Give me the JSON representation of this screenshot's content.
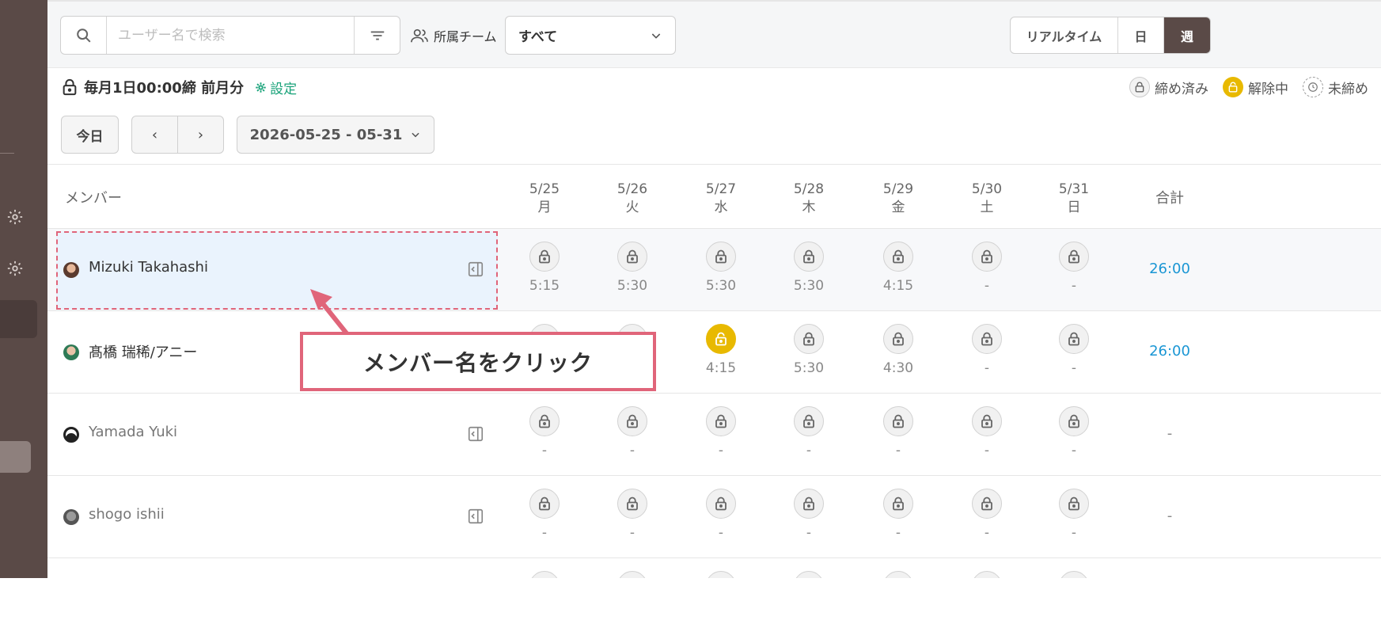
{
  "search": {
    "placeholder": "ユーザー名で検索",
    "value": ""
  },
  "team_filter": {
    "label": "所属チーム",
    "selected": "すべて"
  },
  "view_modes": [
    "リアルタイム",
    "日",
    "週"
  ],
  "view_mode_selected": "週",
  "closing": {
    "text": "毎月1日00:00締 前月分",
    "settings_label": "設定"
  },
  "legend": [
    {
      "label": "締め済み",
      "icon": "lock-closed-icon"
    },
    {
      "label": "解除中",
      "icon": "lock-open-icon"
    },
    {
      "label": "未締め",
      "icon": "clock-icon"
    }
  ],
  "nav": {
    "today": "今日",
    "prev": "‹",
    "next": "›",
    "date_range": "2026-05-25 - 05-31"
  },
  "columns": {
    "member": "メンバー",
    "total": "合計",
    "days": [
      {
        "date": "5/25",
        "weekday": "月"
      },
      {
        "date": "5/26",
        "weekday": "火"
      },
      {
        "date": "5/27",
        "weekday": "水"
      },
      {
        "date": "5/28",
        "weekday": "木"
      },
      {
        "date": "5/29",
        "weekday": "金"
      },
      {
        "date": "5/30",
        "weekday": "土"
      },
      {
        "date": "5/31",
        "weekday": "日"
      }
    ]
  },
  "members": [
    {
      "name": "Mizuki Takahashi",
      "total": "26:00",
      "times": [
        "5:15",
        "5:30",
        "5:30",
        "5:30",
        "4:15",
        "-",
        "-"
      ],
      "status": [
        "closed",
        "closed",
        "closed",
        "closed",
        "closed",
        "closed",
        "closed"
      ]
    },
    {
      "name": "髙橋 瑞稀/アニー",
      "total": "26:00",
      "times": [
        "",
        "",
        "4:15",
        "5:30",
        "4:30",
        "-",
        "-"
      ],
      "status": [
        "closed",
        "closed",
        "open",
        "closed",
        "closed",
        "closed",
        "closed"
      ]
    },
    {
      "name": "Yamada Yuki",
      "total": "-",
      "times": [
        "-",
        "-",
        "-",
        "-",
        "-",
        "-",
        "-"
      ],
      "status": [
        "closed",
        "closed",
        "closed",
        "closed",
        "closed",
        "closed",
        "closed"
      ]
    },
    {
      "name": "shogo ishii",
      "total": "-",
      "times": [
        "-",
        "-",
        "-",
        "-",
        "-",
        "-",
        "-"
      ],
      "status": [
        "closed",
        "closed",
        "closed",
        "closed",
        "closed",
        "closed",
        "closed"
      ]
    }
  ],
  "callout": {
    "text": "メンバー名をクリック"
  },
  "colors": {
    "accent_sidebar": "#5a4a47",
    "link_green": "#1aa37a",
    "total_blue": "#1a96d4",
    "unlock_yellow": "#e8b900",
    "callout_pink": "#e0657a"
  }
}
